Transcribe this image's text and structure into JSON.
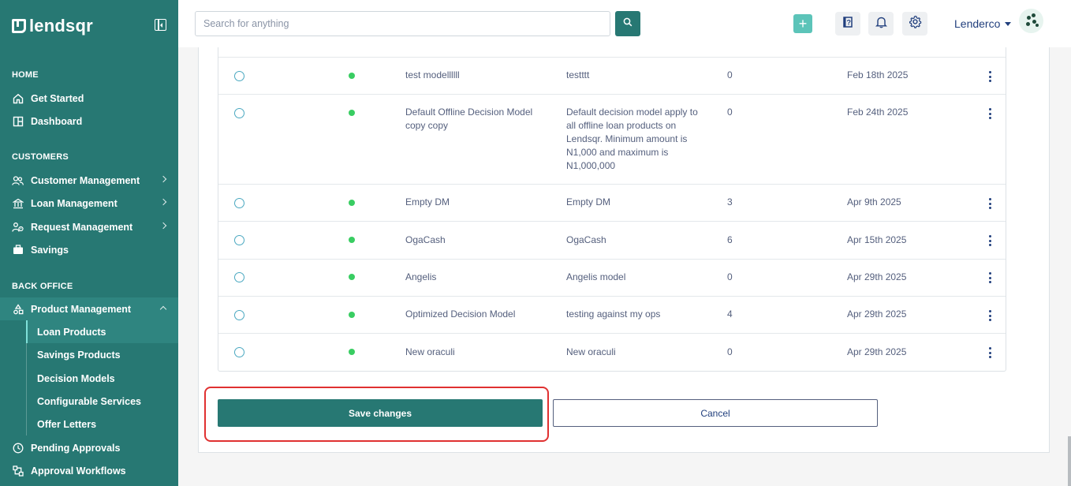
{
  "brand": {
    "name": "lendsqr"
  },
  "sidebar": {
    "sections": {
      "home": "HOME",
      "customers": "CUSTOMERS",
      "back_office": "BACK OFFICE"
    },
    "items": {
      "get_started": "Get Started",
      "dashboard": "Dashboard",
      "customer_management": "Customer Management",
      "loan_management": "Loan Management",
      "request_management": "Request Management",
      "savings": "Savings",
      "product_management": "Product Management",
      "pending_approvals": "Pending Approvals",
      "approval_workflows": "Approval Workflows"
    },
    "product_sub_items": {
      "loan_products": "Loan Products",
      "savings_products": "Savings Products",
      "decision_models": "Decision Models",
      "configurable_services": "Configurable Services",
      "offer_letters": "Offer Letters"
    },
    "active_item": "Loan Products"
  },
  "topbar": {
    "search": {
      "placeholder": "Search for anything",
      "value": ""
    },
    "user_name": "Lenderco",
    "icons": [
      "search-icon",
      "plus-icon",
      "help-icon",
      "bell-icon",
      "gear-icon"
    ]
  },
  "table": {
    "rows": [
      {
        "name": "test modellllll",
        "description": "testttt",
        "count": "0",
        "date": "Feb 18th 2025"
      },
      {
        "name": "Default Offline Decision Model copy copy",
        "description": "Default decision model apply to all offline loan products on Lendsqr. Minimum amount is N1,000 and maximum is N1,000,000",
        "count": "0",
        "date": "Feb 24th 2025"
      },
      {
        "name": "Empty DM",
        "description": "Empty DM",
        "count": "3",
        "date": "Apr 9th 2025"
      },
      {
        "name": "OgaCash",
        "description": "OgaCash",
        "count": "6",
        "date": "Apr 15th 2025"
      },
      {
        "name": "Angelis",
        "description": "Angelis model",
        "count": "0",
        "date": "Apr 29th 2025"
      },
      {
        "name": "Optimized Decision Model",
        "description": "testing against my ops",
        "count": "4",
        "date": "Apr 29th 2025"
      },
      {
        "name": "New oraculi",
        "description": "New oraculi",
        "count": "0",
        "date": "Apr 29th 2025"
      }
    ]
  },
  "actions": {
    "save_label": "Save changes",
    "cancel_label": "Cancel"
  },
  "colors": {
    "brand": "#277873",
    "status_active": "#39cd62",
    "highlight": "#e03131"
  }
}
